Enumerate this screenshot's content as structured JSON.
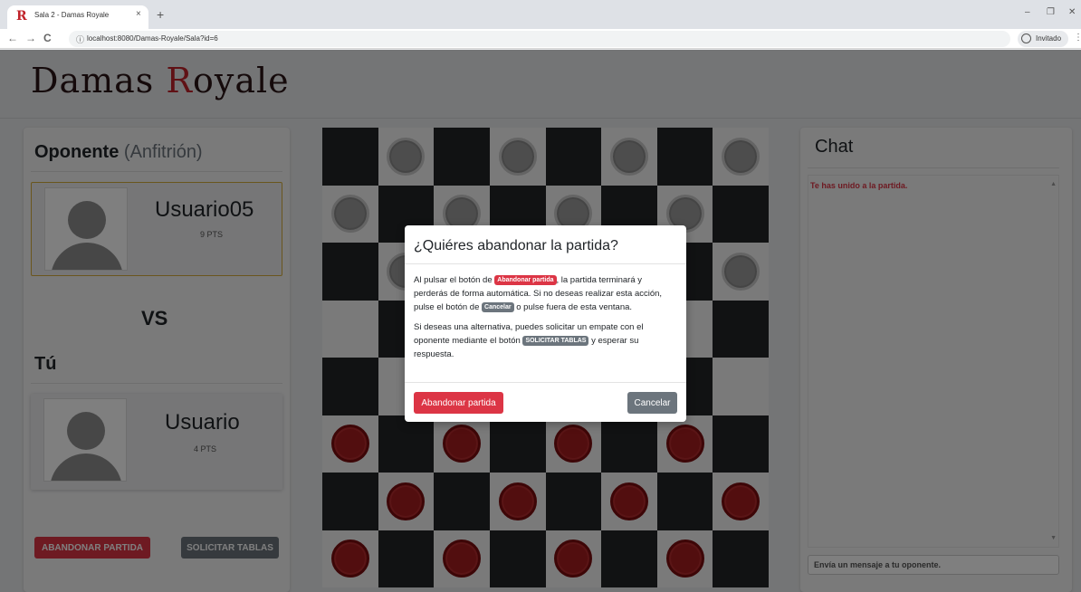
{
  "browser": {
    "tab_title": "Sala 2 - Damas Royale",
    "tab_close": "×",
    "new_tab": "+",
    "url": "localhost:8080/Damas-Royale/Sala?id=6",
    "profile_label": "Invitado",
    "favicon_letter": "R",
    "win_minimize": "–",
    "win_restore": "❐",
    "win_close": "✕",
    "nav_back": "←",
    "nav_forward": "→",
    "nav_reload": "C",
    "url_info": "ⓘ",
    "menu_dots": "⋮"
  },
  "site": {
    "logo_first": "Damas ",
    "logo_r": "R",
    "logo_rest": "oyale"
  },
  "left_panel": {
    "opponent_heading": "Oponente",
    "opponent_role": "(Anfitrión)",
    "opponent": {
      "name": "Usuario05",
      "points": "9 PTS"
    },
    "vs": "VS",
    "self_heading": "Tú",
    "self": {
      "name": "Usuario",
      "points": "4 PTS"
    },
    "abandon_button": "ABANDONAR PARTIDA",
    "draw_button": "SOLICITAR TABLAS"
  },
  "board": {
    "rows": [
      [
        "",
        "w",
        "",
        "w",
        "",
        "w",
        "",
        "w"
      ],
      [
        "w",
        "",
        "w",
        "",
        "w",
        "",
        "w",
        ""
      ],
      [
        "",
        "w",
        "",
        "",
        "",
        "",
        "",
        "w"
      ],
      [
        "",
        "",
        "",
        "",
        "",
        "",
        "",
        ""
      ],
      [
        "",
        "",
        "",
        "",
        "",
        "",
        "",
        ""
      ],
      [
        "r",
        "",
        "r",
        "",
        "r",
        "",
        "r",
        ""
      ],
      [
        "",
        "r",
        "",
        "r",
        "",
        "r",
        "",
        "r"
      ],
      [
        "r",
        "",
        "r",
        "",
        "r",
        "",
        "r",
        ""
      ]
    ]
  },
  "chat": {
    "title": "Chat",
    "messages": [
      "Te has unido a la partida."
    ],
    "input_placeholder": "Envía un mensaje a tu oponente.",
    "scroll_up": "▲",
    "scroll_down": "▼"
  },
  "modal": {
    "title": "¿Quiéres abandonar la partida?",
    "p1_a": "Al pulsar el botón de ",
    "p1_badge": "Abandonar partida",
    "p1_b": ", la partida terminará y perderás de forma automática. Si no deseas realizar esta acción, pulse el botón de ",
    "p1_badge2": "Cancelar",
    "p1_c": " o pulse fuera de esta ventana.",
    "p2_a": "Si deseas una alternativa, puedes solicitar un empate con el oponente mediante el botón ",
    "p2_badge": "SOLICITAR TABLAS",
    "p2_b": " y esperar su respuesta.",
    "confirm_button": "Abandonar partida",
    "cancel_button": "Cancelar"
  },
  "colors": {
    "accent_red": "#dc3545",
    "secondary_gray": "#6c757d",
    "board_dark": "#222427",
    "board_light": "#f4f4f4",
    "opponent_border": "#d4ad3a"
  }
}
